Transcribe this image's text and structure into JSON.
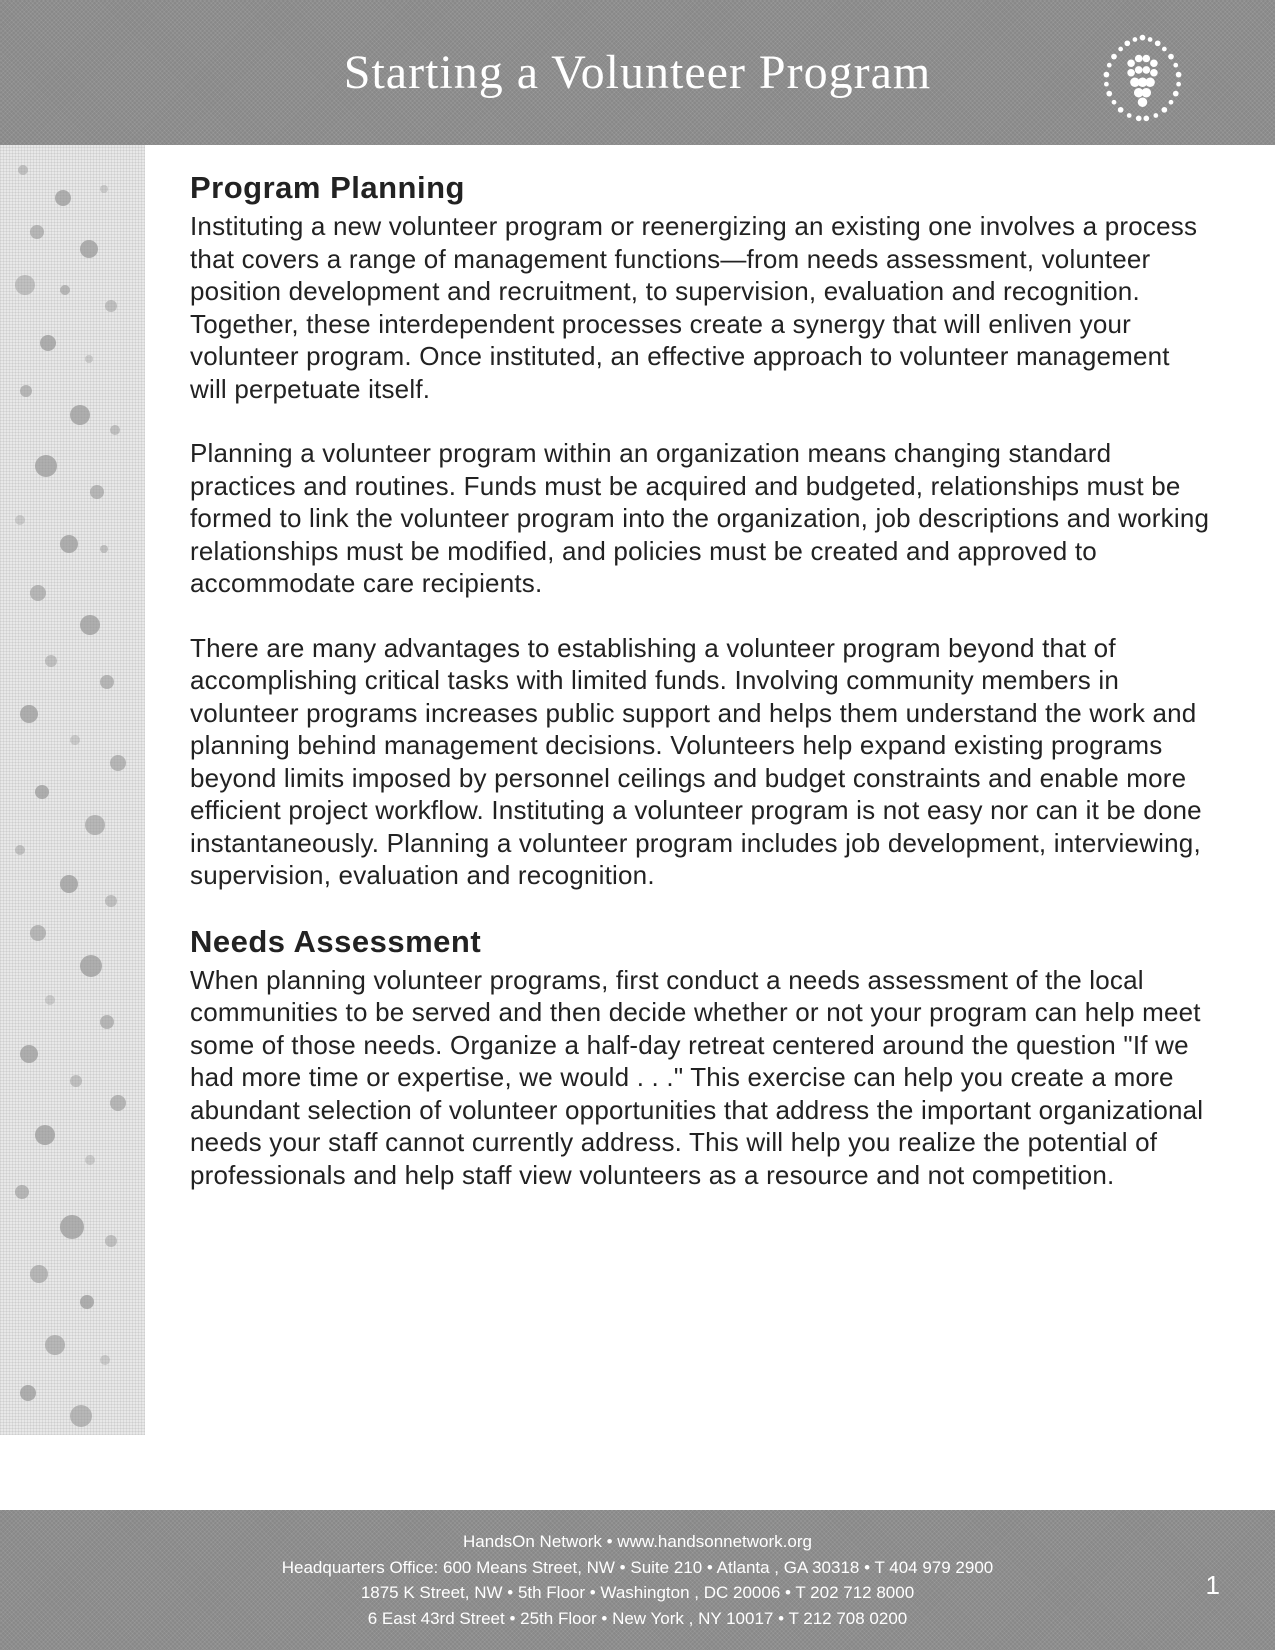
{
  "header": {
    "title": "Starting a Volunteer Program"
  },
  "sections": [
    {
      "heading": "Program Planning",
      "paragraphs": [
        "Instituting a new volunteer program or reenergizing an existing one involves a process that covers a range of management functions—from needs assessment, volunteer position development and recruitment, to supervision, evaluation and recognition. Together, these interdependent processes create a synergy that will enliven your volunteer program. Once instituted, an effective approach to volunteer management will perpetuate itself.",
        "Planning a volunteer program within an organization means changing standard practices and routines. Funds must be acquired and budgeted, relationships must be formed to link the volunteer program into the organization, job descriptions and working relationships must be modified, and policies must be created and approved to accommodate care recipients.",
        "There are many advantages to establishing a volunteer program beyond that of accomplishing critical tasks with limited funds. Involving community members in volunteer programs increases public support and helps them understand the work and planning behind management decisions. Volunteers help expand existing programs beyond limits imposed by personnel ceilings and budget constraints and enable more efficient project workflow. Instituting a volunteer program is not easy nor can it be done instantaneously. Planning a volunteer program includes job development, interviewing, supervision, evaluation and recognition."
      ]
    },
    {
      "heading": "Needs Assessment",
      "paragraphs": [
        "When planning volunteer programs, first conduct a needs assessment of the local communities to be served and then decide whether or not your program can help meet some of those needs. Organize a half-day retreat centered around the question \"If we had more time or expertise, we would . . .\" This exercise can help you create a more abundant selection of volunteer opportunities that address the important organizational needs your staff cannot currently address. This will help you realize the potential of professionals and help staff view volunteers as a resource and not competition."
      ]
    }
  ],
  "footer": {
    "line1": "HandsOn Network • www.handsonnetwork.org",
    "line2": "Headquarters Office: 600 Means Street, NW • Suite 210 • Atlanta , GA 30318 • T 404 979 2900",
    "line3": "1875 K Street, NW • 5th Floor • Washington , DC 20006 • T 202 712 8000",
    "line4": "6 East 43rd Street • 25th Floor • New York , NY 10017 • T 212 708 0200"
  },
  "page_number": "1"
}
